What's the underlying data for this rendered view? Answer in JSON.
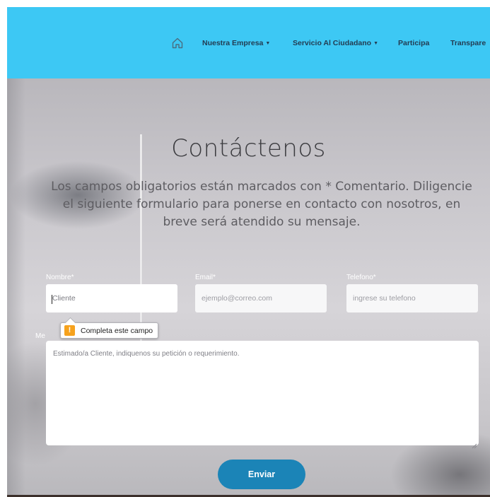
{
  "nav": {
    "home_icon": "home-icon",
    "items": [
      {
        "label": "Nuestra Empresa",
        "dropdown": true
      },
      {
        "label": "Servicio Al Ciudadano",
        "dropdown": true
      },
      {
        "label": "Participa",
        "dropdown": false
      },
      {
        "label": "Transpare",
        "dropdown": false
      }
    ],
    "caret": "▼",
    "bar_color": "#3dc8f4"
  },
  "hero": {
    "title": "Contáctenos",
    "subtitle": "Los campos obligatorios están marcados con * Comentario. Diligencie el siguiente formulario para ponerse en contacto con nosotros, en breve será atendido su mensaje."
  },
  "form": {
    "name": {
      "label": "Nombre*",
      "value": "",
      "placeholder": "Cliente"
    },
    "email": {
      "label": "Email*",
      "value": "",
      "placeholder": "ejemplo@correo.com"
    },
    "phone": {
      "label": "Telefono*",
      "value": "",
      "placeholder": "ingrese su telefono"
    },
    "message": {
      "label": "Me",
      "value": "",
      "placeholder": "Estimado/a Cliente, indiquenos su petición o requerimiento."
    },
    "validation_tooltip": {
      "icon": "warning-icon",
      "text": "Completa este campo"
    },
    "submit_label": "Enviar",
    "submit_color": "#1b84b7"
  }
}
